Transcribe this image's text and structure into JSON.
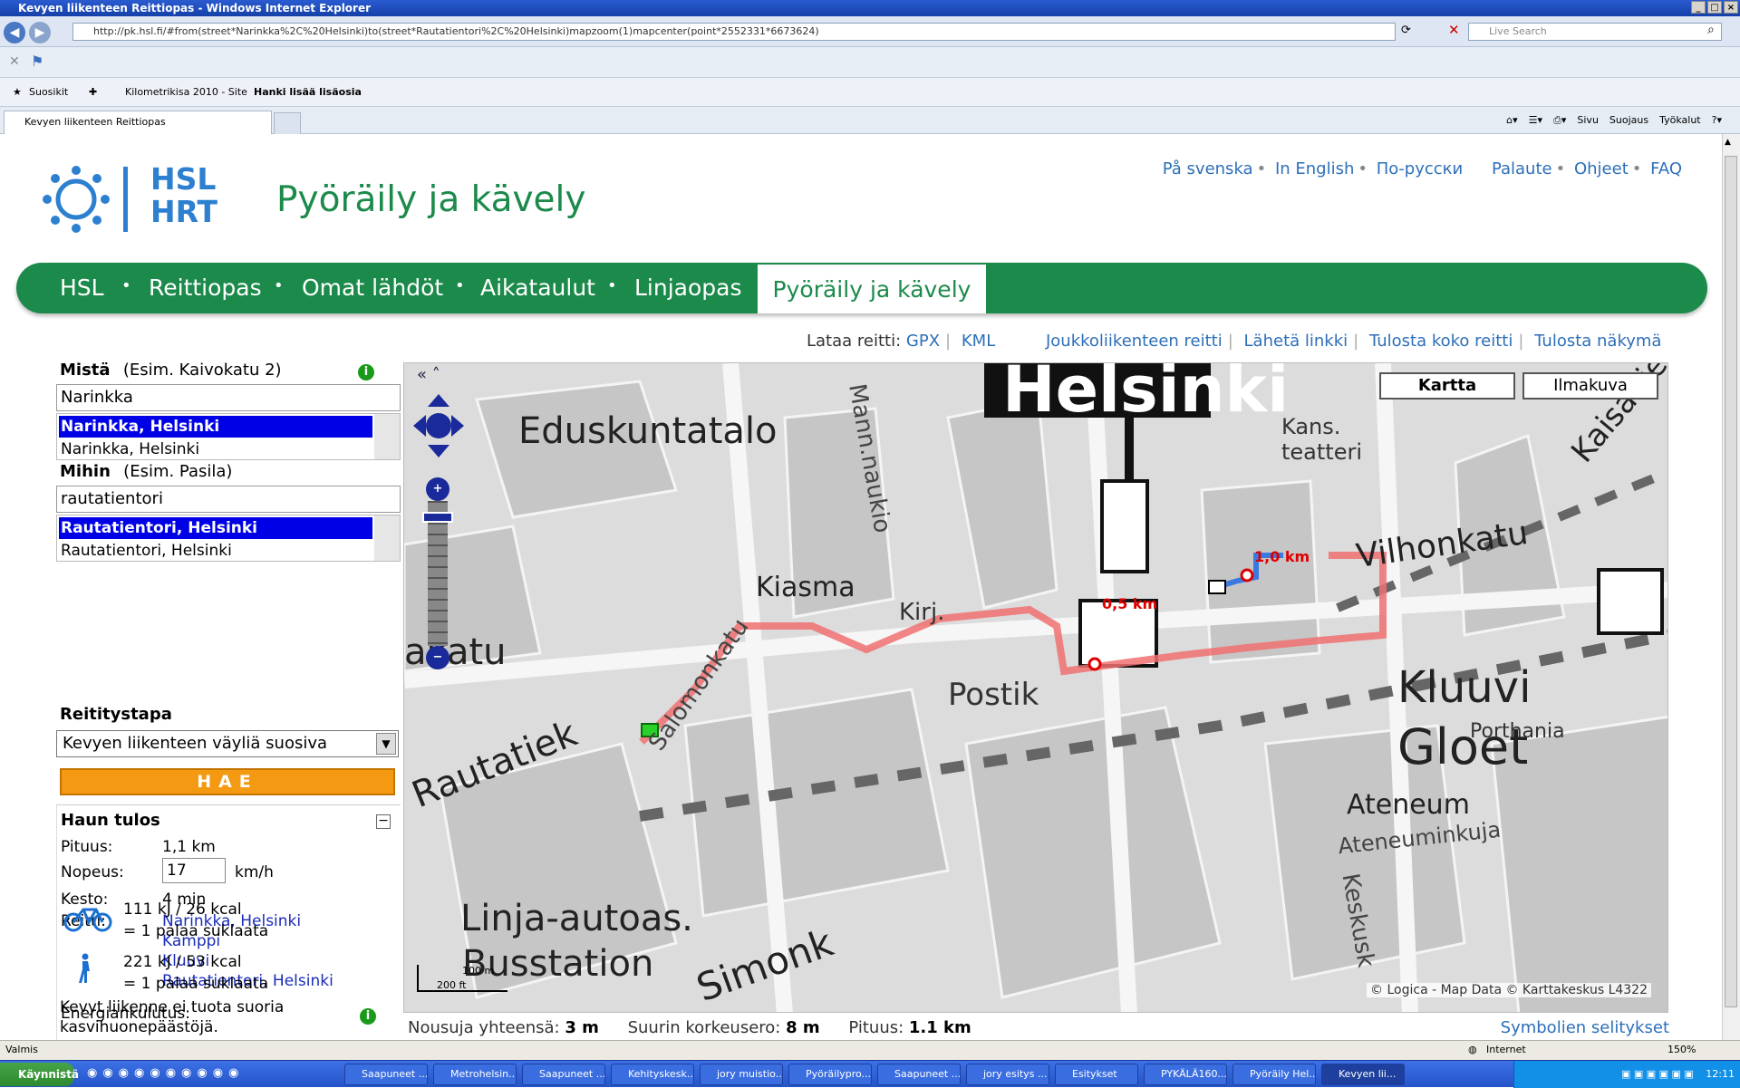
{
  "window": {
    "title": "Kevyen liikenteen Reittiopas - Windows Internet Explorer"
  },
  "browser": {
    "address": "http://pk.hsl.fi/#from(street*Narinkka%2C%20Helsinki)to(street*Rautatientori%2C%20Helsinki)mapzoom(1)mapcenter(point*2552331*6673624)",
    "search_placeholder": "Live Search",
    "favorites_label": "Suosikit",
    "fav1": "Kilometrikisa 2010 - Site",
    "fav2": "Hanki lisää lisäosia",
    "tab_title": "Kevyen liikenteen Reittiopas",
    "cmd_sivu": "Sivu",
    "cmd_suojaus": "Suojaus",
    "cmd_tyokalut": "Työkalut"
  },
  "site": {
    "logo_line1": "HSL",
    "logo_line2": "HRT",
    "brand": "Pyöräily ja kävely",
    "lang_sv": "På svenska",
    "lang_en": "In English",
    "lang_ru": "По-русски",
    "palaute": "Palaute",
    "ohjeet": "Ohjeet",
    "faq": "FAQ"
  },
  "nav": {
    "hsl": "HSL",
    "reittiopas": "Reittiopas",
    "omat": "Omat lähdöt",
    "aikataulut": "Aikataulut",
    "linjaopas": "Linjaopas",
    "active": "Pyöräily ja kävely"
  },
  "tools": {
    "lataa": "Lataa reitti:",
    "gpx": "GPX",
    "kml": "KML",
    "joukko": "Joukkoliikenteen reitti",
    "laheta": "Lähetä linkki",
    "tulosta_koko": "Tulosta koko reitti",
    "tulosta_nakyma": "Tulosta näkymä"
  },
  "form": {
    "from_label": "Mistä",
    "from_hint": "(Esim. Kaivokatu 2)",
    "from_value": "Narinkka",
    "from_selected": "Narinkka, Helsinki",
    "from_option": "Narinkka, Helsinki",
    "to_label": "Mihin",
    "to_hint": "(Esim. Pasila)",
    "to_value": "rautatientori",
    "to_selected": "Rautatientori, Helsinki",
    "to_option": "Rautatientori, Helsinki",
    "mode_label": "Reititystapa",
    "mode_value": "Kevyen liikenteen väyliä suosiva",
    "search_button": "HAE"
  },
  "result": {
    "title": "Haun tulos",
    "pituus_label": "Pituus:",
    "pituus_value": "1,1 km",
    "nopeus_label": "Nopeus:",
    "nopeus_value": "17",
    "nopeus_unit": "km/h",
    "kesto_label": "Kesto:",
    "kesto_value": "4 min",
    "reitti_label": "Reitti:",
    "route": [
      "Narinkka, Helsinki",
      "Kamppi",
      "Kluuvi",
      "Rautatientori, Helsinki"
    ],
    "energy_label": "Energiankulutus:",
    "bike_energy": "111 kJ / 26 kcal",
    "bike_choc": "= 1 palaa suklaata",
    "walk_energy": "221 kJ / 53 kcal",
    "walk_choc": "= 1 palaa suklaata",
    "note_line1": "Kevyt liikenne ei tuota suoria",
    "note_line2": "kasvihuonepäästöjä."
  },
  "map": {
    "btn_map": "Kartta",
    "btn_aerial": "Ilmakuva",
    "copyright": "© Logica - Map Data © Karttakeskus L4322",
    "km05": "0,5 km",
    "km10": "1,0 km",
    "scale_m": "100 m",
    "scale_ft": "200 ft",
    "labels": [
      "Helsinki",
      "Eduskuntatalo",
      "Kiasma",
      "Kluuvi",
      "Gloet",
      "Vilhonkatu",
      "Postik",
      "Rautatiek",
      "Linja-autoas.",
      "Busstation",
      "Simonk",
      "Ateneum",
      "Porthania",
      "Kaisanie",
      "Kans. teatteri",
      "Mann.naukio",
      "Salomonkatu",
      "Kirj.",
      "Keskusk",
      "Ateneuminkuja",
      "akatu"
    ]
  },
  "footer": {
    "nousuja_label": "Nousuja yhteensä:",
    "nousuja_value": "3 m",
    "korkeus_label": "Suurin korkeusero:",
    "korkeus_value": "8 m",
    "pituus_label": "Pituus:",
    "pituus_value": "1.1 km",
    "symbols": "Symbolien selitykset"
  },
  "status": {
    "left": "Valmis",
    "zone": "Internet",
    "zoom": "150%"
  },
  "taskbar": {
    "start": "Käynnistä",
    "items": [
      "Saapuneet ...",
      "Metrohelsin...",
      "Saapuneet ...",
      "Kehityskesk...",
      "jory muistio...",
      "Pyöräilypro...",
      "Saapuneet ...",
      "jory esitys ...",
      "Esitykset",
      "PYKÄLÄ160...",
      "Pyöräily Hel...",
      "Kevyen lii..."
    ],
    "clock": "12:11"
  }
}
